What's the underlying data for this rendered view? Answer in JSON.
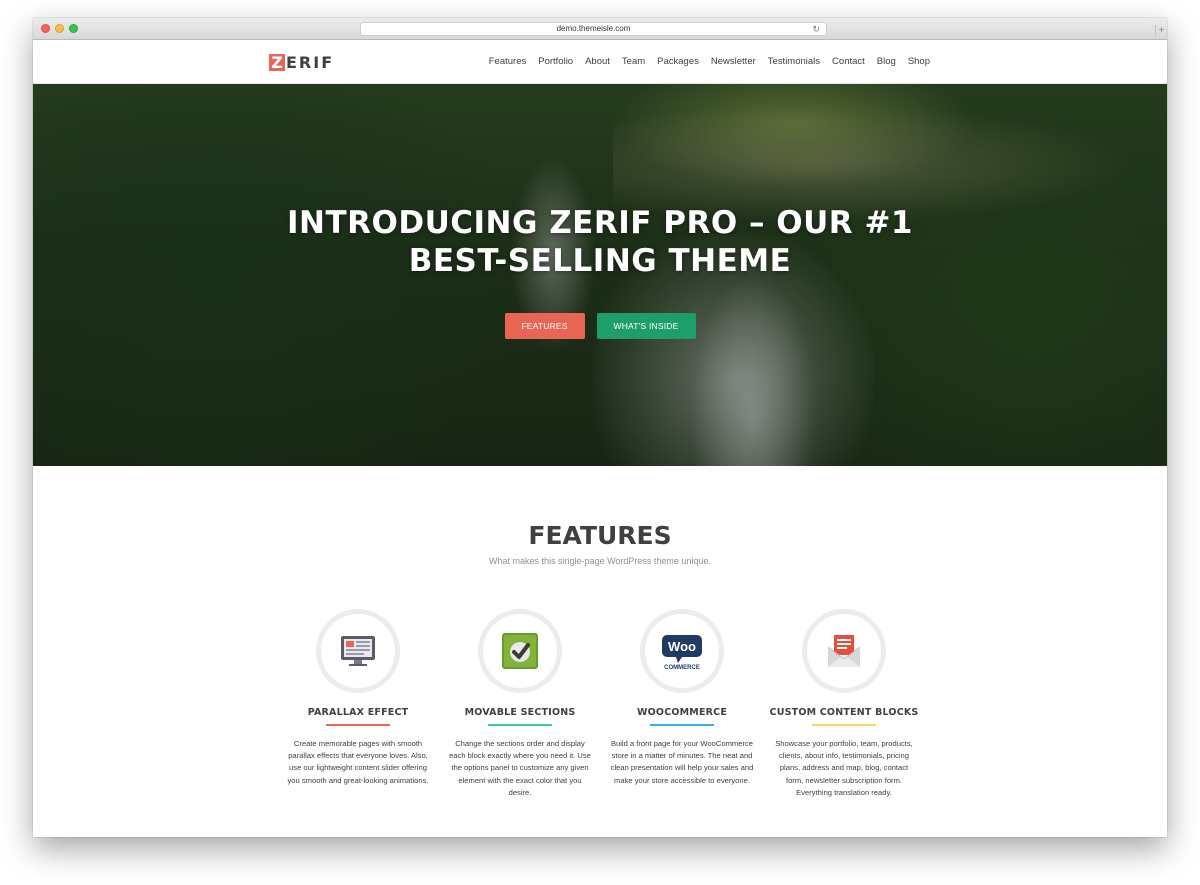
{
  "browser": {
    "url": "demo.themeisle.com"
  },
  "logo": {
    "initial": "Z",
    "rest": "ERIF"
  },
  "nav": {
    "items": [
      "Features",
      "Portfolio",
      "About",
      "Team",
      "Packages",
      "Newsletter",
      "Testimonials",
      "Contact",
      "Blog",
      "Shop"
    ]
  },
  "hero": {
    "title_line1": "INTRODUCING ZERIF PRO – OUR #1",
    "title_line2": "BEST-SELLING THEME",
    "btn_features": "FEATURES",
    "btn_inside": "WHAT'S INSIDE"
  },
  "features": {
    "title": "FEATURES",
    "subtitle": "What makes this single-page WordPress theme unique.",
    "items": [
      {
        "name": "PARALLAX EFFECT",
        "icon": "monitor-icon",
        "accent": "#e96656",
        "desc": "Create memorable pages with smooth parallax effects that everyone loves. Also, use our lightweight content slider offering you smooth and great-looking animations."
      },
      {
        "name": "MOVABLE SECTIONS",
        "icon": "checkmark-icon",
        "accent": "#34d293",
        "desc": "Change the sections order and display each block exactly where you need it. Use the options panel to customize any given element with the exact color that you desire."
      },
      {
        "name": "WOOCOMMERCE",
        "icon": "woocommerce-icon",
        "accent": "#3ab0e2",
        "desc": "Build a front page for your WooCommerce store in a matter of minutes. The neat and clean presentation will help your sales and make your store accessible to everyone."
      },
      {
        "name": "CUSTOM CONTENT BLOCKS",
        "icon": "envelope-icon",
        "accent": "#f7d861",
        "desc": "Showcase your portfolio, team, products, clients, about info, testimonials, pricing plans, address and map, blog, contact form, newsletter subscription form. Everything translation ready."
      }
    ]
  }
}
